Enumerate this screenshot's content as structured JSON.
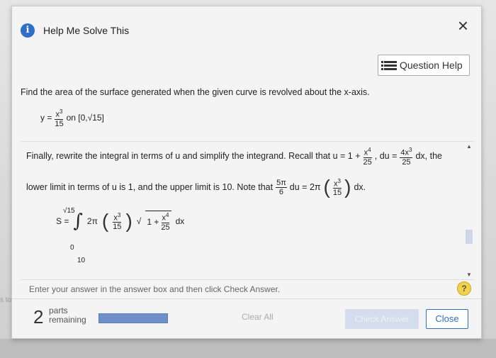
{
  "background": {
    "edge_text": "s to se"
  },
  "dialog": {
    "title": "Help Me Solve This",
    "close_glyph": "×",
    "question_help_label": "Question Help"
  },
  "question": {
    "text": "Find the area of the surface generated when the given curve is revolved about the x-axis.",
    "curve_lhs": "y =",
    "curve_num": "x",
    "curve_num_exp": "3",
    "curve_den": "15",
    "interval_text": "on [0,√15]"
  },
  "step": {
    "line1_prefix": "Finally, rewrite the integral in terms of u and simplify the integrand. Recall that u = 1 +",
    "u_num": "x",
    "u_num_exp": "4",
    "u_den": "25",
    "du_text": ", du =",
    "du_num": "4x",
    "du_num_exp": "3",
    "du_den": "25",
    "line1_suffix": "dx, the",
    "line2_prefix": "lower limit in terms of u is 1, and the upper limit is 10. Note that",
    "pi_num": "5π",
    "pi_den": "6",
    "line2_mid": "du = 2π",
    "inner_num": "x",
    "inner_num_exp": "3",
    "inner_den": "15",
    "line2_suffix": "dx.",
    "integral_label": "S =",
    "upper_limit": "√15",
    "lower_limit": "0",
    "two_pi": "2π",
    "frac_num": "x",
    "frac_num_exp": "3",
    "frac_den": "15",
    "root_one": "1 +",
    "root_num": "x",
    "root_num_exp": "4",
    "root_den": "25",
    "dx": "dx",
    "ten": "10"
  },
  "instructions": "Enter your answer in the answer box and then click Check Answer.",
  "hint_label": "?",
  "footer": {
    "parts_count": "2",
    "parts_label_top": "parts",
    "parts_label_bottom": "remaining",
    "progress": 1.0,
    "clear_all": "Clear All",
    "check_answer": "Check Answer",
    "close": "Close"
  }
}
